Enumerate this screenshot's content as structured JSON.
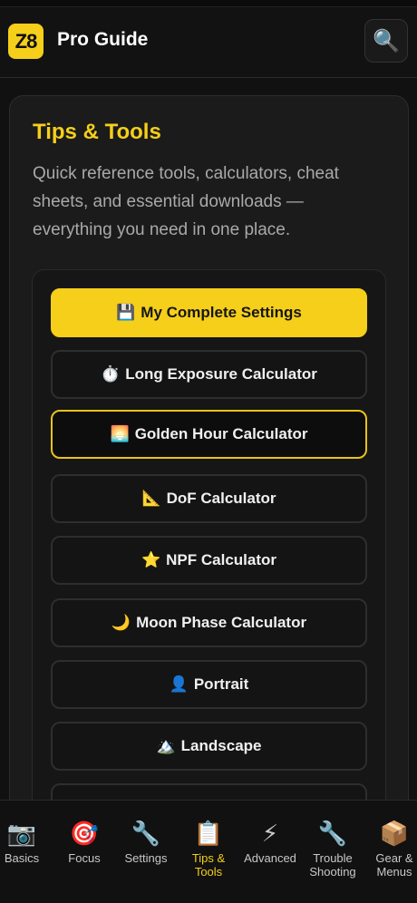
{
  "header": {
    "logo": "Z8",
    "title": "Pro Guide",
    "search_icon": "🔍"
  },
  "panel": {
    "title": "Tips & Tools",
    "description": "Quick reference tools, calculators, cheat sheets, and essential downloads — everything you need in one place."
  },
  "tools": [
    {
      "icon": "💾",
      "label": "My Complete Settings"
    },
    {
      "icon": "⏱️",
      "label": "Long Exposure Calculator"
    },
    {
      "icon": "🌅",
      "label": "Golden Hour Calculator"
    },
    {
      "icon": "📐",
      "label": "DoF Calculator"
    },
    {
      "icon": "⭐",
      "label": "NPF Calculator"
    },
    {
      "icon": "🌙",
      "label": "Moon Phase Calculator"
    },
    {
      "icon": "👤",
      "label": "Portrait"
    },
    {
      "icon": "🏔️",
      "label": "Landscape"
    }
  ],
  "nav": [
    {
      "icon": "📷",
      "label": "Basics"
    },
    {
      "icon": "🎯",
      "label": "Focus"
    },
    {
      "icon": "🔧",
      "label": "Settings"
    },
    {
      "icon": "📋",
      "label": "Tips & Tools"
    },
    {
      "icon": "⚡",
      "label": "Advanced"
    },
    {
      "icon": "🔧",
      "label": "Trouble Shooting"
    },
    {
      "icon": "📦",
      "label": "Gear & Menus"
    }
  ],
  "colors": {
    "accent": "#f5cf1a",
    "background": "#111111",
    "panel": "#1b1b1b"
  }
}
